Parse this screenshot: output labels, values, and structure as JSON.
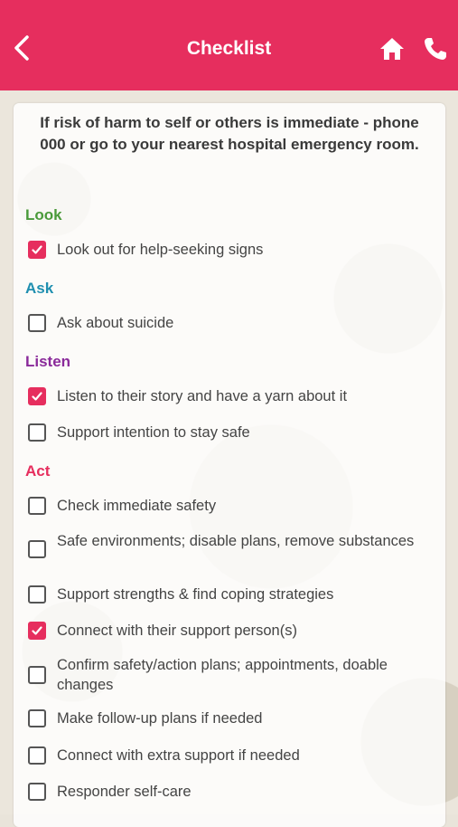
{
  "header": {
    "title": "Checklist"
  },
  "warning": "If risk of harm to self or others is immediate - phone 000 or go to your nearest hospital emergency room.",
  "colors": {
    "accent": "#e62e5e",
    "look": "#4a9a3a",
    "ask": "#1f8fb0",
    "listen": "#8a2a9a",
    "act": "#e62e5e"
  },
  "sections": {
    "look": {
      "title": "Look",
      "items": [
        {
          "label": "Look out for help-seeking signs",
          "checked": true
        }
      ]
    },
    "ask": {
      "title": "Ask",
      "items": [
        {
          "label": "Ask about suicide",
          "checked": false
        }
      ]
    },
    "listen": {
      "title": "Listen",
      "items": [
        {
          "label": "Listen to their story and have a yarn about it",
          "checked": true
        },
        {
          "label": "Support intention to stay safe",
          "checked": false
        }
      ]
    },
    "act": {
      "title": "Act",
      "items": [
        {
          "label": "Check immediate safety",
          "checked": false
        },
        {
          "label": "Safe environments; disable plans, remove substances",
          "checked": false
        },
        {
          "label": "Support strengths & find coping strategies",
          "checked": false
        },
        {
          "label": "Connect with their support person(s)",
          "checked": true
        },
        {
          "label": "Confirm safety/action plans; appointments, doable changes",
          "checked": false
        },
        {
          "label": "Make follow-up plans if needed",
          "checked": false
        },
        {
          "label": "Connect with extra support if needed",
          "checked": false
        },
        {
          "label": "Responder self-care",
          "checked": false
        }
      ]
    }
  }
}
